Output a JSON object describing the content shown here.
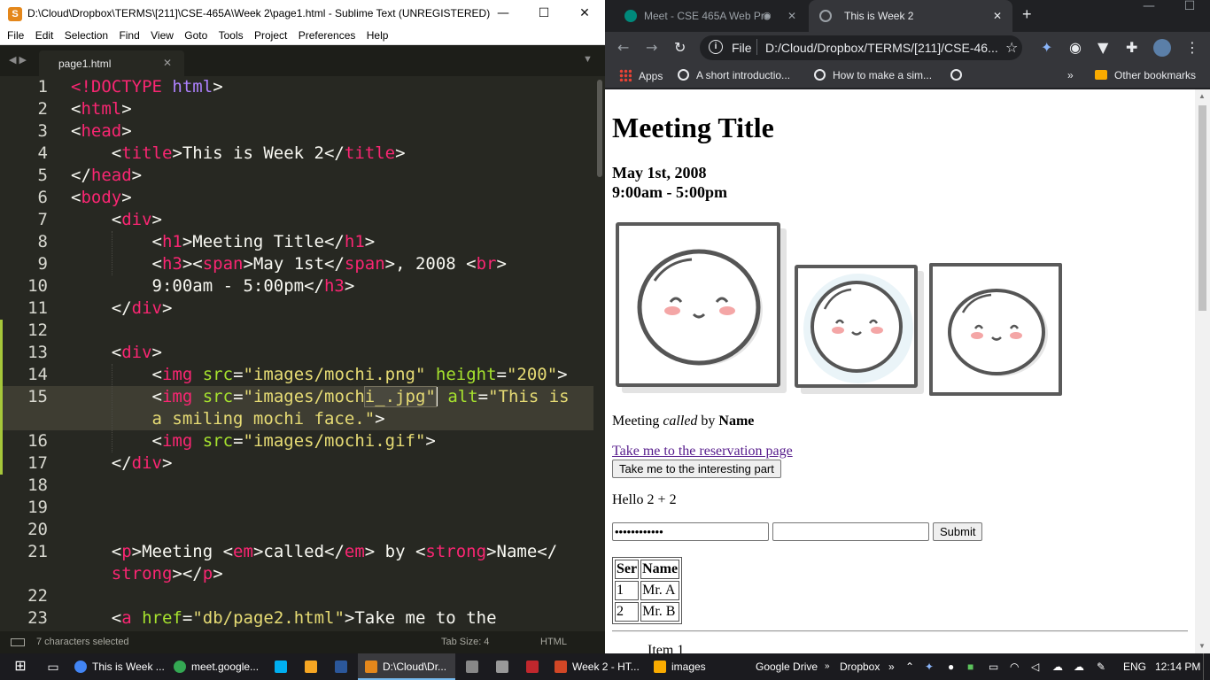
{
  "sublime": {
    "title": "D:\\Cloud\\Dropbox\\TERMS\\[211]\\CSE-465A\\Week 2\\page1.html - Sublime Text (UNREGISTERED)",
    "menu": [
      "File",
      "Edit",
      "Selection",
      "Find",
      "View",
      "Goto",
      "Tools",
      "Project",
      "Preferences",
      "Help"
    ],
    "tab_label": "page1.html",
    "line_numbers": [
      "1",
      "2",
      "3",
      "4",
      "5",
      "6",
      "7",
      "8",
      "9",
      "10",
      "11",
      "12",
      "13",
      "14",
      "15",
      "16",
      "17",
      "18",
      "19",
      "20",
      "21",
      "22",
      "23"
    ],
    "status": {
      "selection": "7 characters selected",
      "tab_size": "Tab Size: 4",
      "syntax": "HTML"
    }
  },
  "chrome": {
    "tabs": [
      {
        "label": "Meet - CSE 465A Web Pro",
        "active": false
      },
      {
        "label": "This is Week 2",
        "active": true
      }
    ],
    "address": {
      "scheme": "File",
      "url": "D:/Cloud/Dropbox/TERMS/[211]/CSE-46..."
    },
    "bookmarks": [
      "Apps",
      "A short introductio...",
      "How to make a sim...",
      "Other bookmarks"
    ]
  },
  "page": {
    "h1": "Meeting Title",
    "date": "May 1st, 2008",
    "time": "9:00am - 5:00pm",
    "para_pre": "Meeting ",
    "para_em": "called",
    "para_mid": " by ",
    "para_strong": "Name",
    "link": "Take me to the reservation page",
    "button": "Take me to the interesting part",
    "hello": "Hello 2 + 2",
    "password_mask": "••••••••••••",
    "submit": "Submit",
    "table": {
      "headers": [
        "Ser",
        "Name"
      ],
      "rows": [
        [
          "1",
          "Mr. A"
        ],
        [
          "2",
          "Mr. B"
        ]
      ]
    },
    "list_item_partial": "Item 1"
  },
  "taskbar": {
    "items": [
      {
        "label": "This is Week ...",
        "color": "#4285f4"
      },
      {
        "label": "meet.google...",
        "color": "#34a853"
      },
      {
        "label": "",
        "color": "#00aff0"
      },
      {
        "label": "",
        "color": "#f6a623"
      },
      {
        "label": "",
        "color": "#2b579a"
      },
      {
        "label": "D:\\Cloud\\Dr...",
        "color": "#e4871b"
      },
      {
        "label": "",
        "color": "#888888"
      },
      {
        "label": "",
        "color": "#999999"
      },
      {
        "label": "",
        "color": "#c1272d"
      },
      {
        "label": "Week 2 - HT...",
        "color": "#d24726"
      },
      {
        "label": "images",
        "color": "#f9ab00"
      }
    ],
    "tray_text": [
      "Google Drive",
      "Dropbox"
    ],
    "language": "ENG",
    "clock": "12:14 PM"
  },
  "colors": {
    "sublime_bg": "#272822",
    "tag": "#f92672",
    "attr": "#a6e22e",
    "string": "#e6db74",
    "doctype": "#ae81ff",
    "chrome_dark": "#35363a"
  }
}
